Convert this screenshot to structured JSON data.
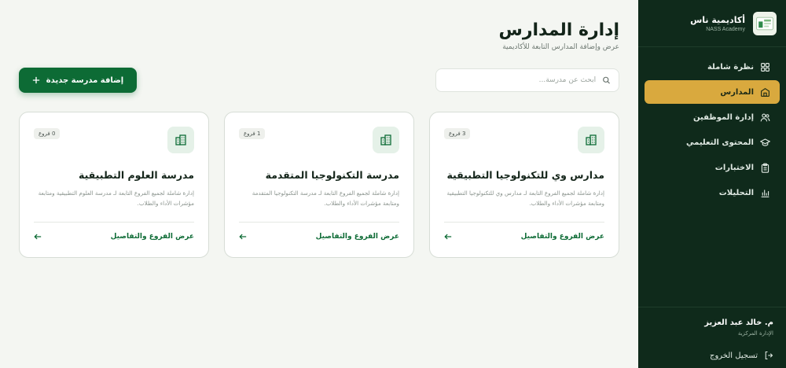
{
  "brand": {
    "name": "أكاديمية ناس",
    "sub": "NASS Academy"
  },
  "sidebar": {
    "items": [
      {
        "label": "نظرة شاملة",
        "icon": "grid-icon",
        "active": false
      },
      {
        "label": "المدارس",
        "icon": "school-icon",
        "active": true
      },
      {
        "label": "إدارة الموظفين",
        "icon": "users-icon",
        "active": false
      },
      {
        "label": "المحتوى التعليمي",
        "icon": "graduation-cap-icon",
        "active": false
      },
      {
        "label": "الاختبارات",
        "icon": "clipboard-icon",
        "active": false
      },
      {
        "label": "التحليلات",
        "icon": "bar-chart-icon",
        "active": false
      }
    ]
  },
  "user": {
    "name": "م. خالد عبد العزيز",
    "role": "الإدارة المركزية",
    "logout_label": "تسجيل الخروج"
  },
  "header": {
    "title": "إدارة المدارس",
    "subtitle": "عرض وإضافة المدارس التابعة للأكاديمية"
  },
  "search": {
    "placeholder": "ابحث عن مدرسة...",
    "value": ""
  },
  "add_button": {
    "label": "إضافة مدرسة جديدة"
  },
  "cards": [
    {
      "badge": "3 فروع",
      "title": "مدارس وي للتكنولوجيا التطبيقية",
      "description": "إدارة شاملة لجميع الفروع التابعة لـ مدارس وي للتكنولوجيا التطبيقية ومتابعة مؤشرات الأداء والطلاب.",
      "link": "عرض الفروع والتفاصيل"
    },
    {
      "badge": "1 فروع",
      "title": "مدرسة التكنولوجيا المتقدمة",
      "description": "إدارة شاملة لجميع الفروع التابعة لـ مدرسة التكنولوجيا المتقدمة ومتابعة مؤشرات الأداء والطلاب.",
      "link": "عرض الفروع والتفاصيل"
    },
    {
      "badge": "0 فروع",
      "title": "مدرسة العلوم التطبيقية",
      "description": "إدارة شاملة لجميع الفروع التابعة لـ مدرسة العلوم التطبيقية ومتابعة مؤشرات الأداء والطلاب.",
      "link": "عرض الفروع والتفاصيل"
    }
  ],
  "colors": {
    "sidebar_bg": "#0f2a1b",
    "active_item": "#d9a93e",
    "primary": "#0d6b35",
    "page_bg": "#f4f6f2"
  }
}
